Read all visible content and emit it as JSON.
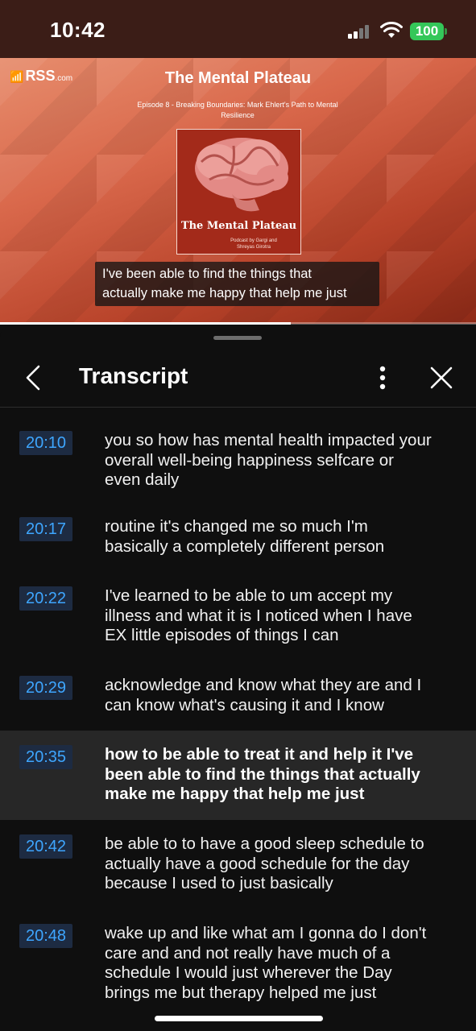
{
  "status_bar": {
    "time": "10:42",
    "battery": "100",
    "battery_color": "#34c759"
  },
  "player": {
    "source_logo": "RSS",
    "source_logo_suffix": ".com",
    "podcast_title": "The Mental Plateau",
    "episode_title": "Episode 8 - Breaking Boundaries: Mark Ehlert's Path to Mental Resilience",
    "cover": {
      "title": "The Mental Plateau",
      "subtitle_line1": "Podcast by Gargi and",
      "subtitle_line2": "Shreyas Girotra",
      "icon": "brain-illustration"
    },
    "caption_lines": [
      "I've been able to find the things that",
      "actually make me happy that help me just"
    ],
    "progress_fraction": 0.61
  },
  "panel": {
    "title": "Transcript",
    "icons": {
      "back": "chevron-left-icon",
      "more": "more-vertical-icon",
      "close": "close-icon"
    }
  },
  "transcript": [
    {
      "time": "20:10",
      "lines": [
        "you so how has mental health impacted your",
        "overall well-being happiness selfcare or",
        "even daily"
      ],
      "active": false
    },
    {
      "time": "20:17",
      "lines": [
        "routine it's changed me so much I'm",
        "basically a completely different person"
      ],
      "active": false
    },
    {
      "time": "20:22",
      "lines": [
        "I've learned to be able to um accept my",
        "illness and what it is I noticed when I have",
        "EX little episodes of things I can"
      ],
      "active": false
    },
    {
      "time": "20:29",
      "lines": [
        "acknowledge and know what they are and I",
        "can know what's causing it and I know"
      ],
      "active": false
    },
    {
      "time": "20:35",
      "lines": [
        "how to be able to treat it and help it I've",
        "been able to find the things that actually",
        "make me happy that help me just"
      ],
      "active": true
    },
    {
      "time": "20:42",
      "lines": [
        "be able to to have a good sleep schedule to",
        "actually have a good schedule for the day",
        "because I used to just basically"
      ],
      "active": false
    },
    {
      "time": "20:48",
      "lines": [
        "wake up and like what am I gonna do I don't",
        "care and and not really have much of a",
        "schedule I would just wherever the Day",
        "brings me but therapy helped me just"
      ],
      "active": false
    }
  ]
}
